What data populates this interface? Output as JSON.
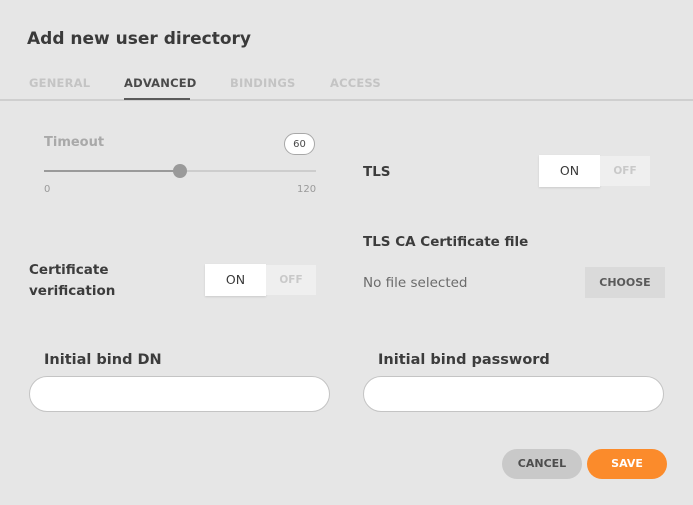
{
  "dialog": {
    "title": "Add new user directory"
  },
  "tabs": [
    {
      "label": "GENERAL",
      "active": false
    },
    {
      "label": "ADVANCED",
      "active": true
    },
    {
      "label": "BINDINGS",
      "active": false
    },
    {
      "label": "ACCESS",
      "active": false
    }
  ],
  "timeout": {
    "label": "Timeout",
    "value": "60",
    "min": "0",
    "max": "120",
    "fraction": 0.5
  },
  "tls": {
    "label": "TLS",
    "on_label": "ON",
    "off_label": "OFF",
    "state": "on"
  },
  "tls_ca": {
    "label": "TLS CA Certificate file",
    "file_text": "No file selected",
    "choose_label": "CHOOSE"
  },
  "cert_verification": {
    "label_line1": "Certificate",
    "label_line2": "verification",
    "on_label": "ON",
    "off_label": "OFF",
    "state": "on"
  },
  "bind_dn": {
    "label": "Initial bind DN",
    "value": ""
  },
  "bind_password": {
    "label": "Initial bind password",
    "value": ""
  },
  "footer": {
    "cancel_label": "CANCEL",
    "save_label": "SAVE"
  },
  "colors": {
    "accent": "#fb8b2b",
    "background": "#e6e6e6"
  }
}
